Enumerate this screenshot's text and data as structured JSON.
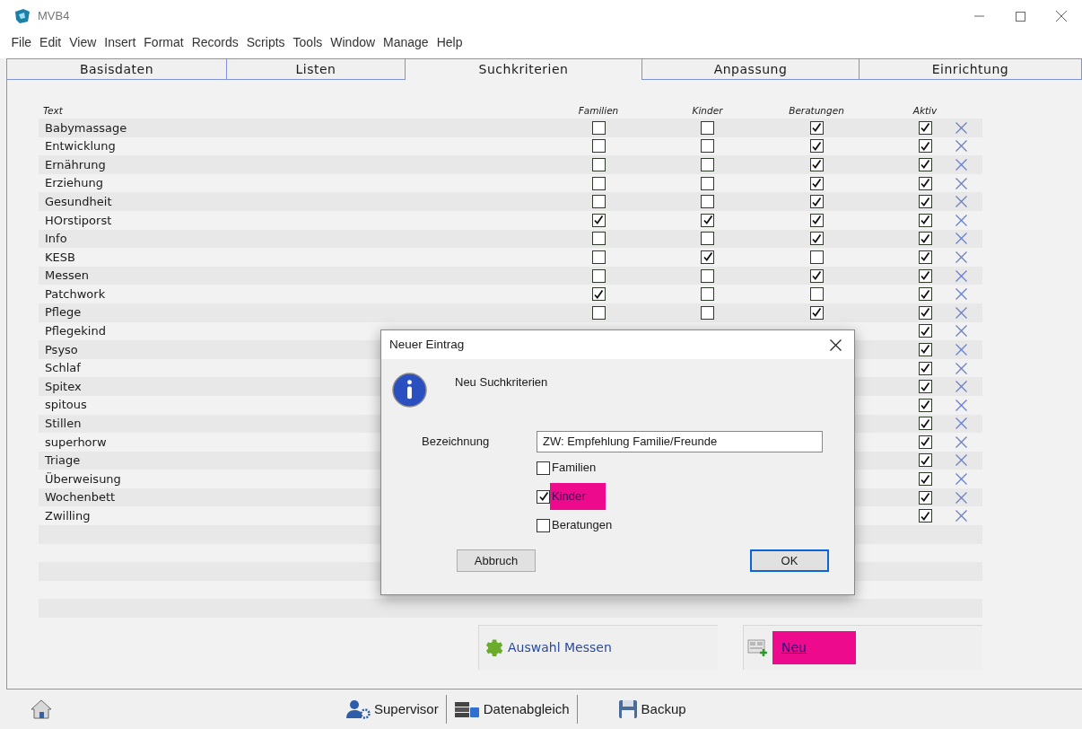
{
  "window": {
    "title": "MVB4"
  },
  "menu": [
    "File",
    "Edit",
    "View",
    "Insert",
    "Format",
    "Records",
    "Scripts",
    "Tools",
    "Window",
    "Manage",
    "Help"
  ],
  "tabs": [
    {
      "label": "Basisdaten",
      "selected": false
    },
    {
      "label": "Listen",
      "selected": false
    },
    {
      "label": "Suchkriterien",
      "selected": true
    },
    {
      "label": "Anpassung",
      "selected": false
    },
    {
      "label": "Einrichtung",
      "selected": false
    }
  ],
  "table": {
    "columns": [
      "Text",
      "Familien",
      "Kinder",
      "Beratungen",
      "Aktiv"
    ],
    "rows": [
      {
        "text": "Babymassage",
        "familien": false,
        "kinder": false,
        "beratungen": true,
        "aktiv": true
      },
      {
        "text": "Entwicklung",
        "familien": false,
        "kinder": false,
        "beratungen": true,
        "aktiv": true
      },
      {
        "text": "Ernährung",
        "familien": false,
        "kinder": false,
        "beratungen": true,
        "aktiv": true
      },
      {
        "text": "Erziehung",
        "familien": false,
        "kinder": false,
        "beratungen": true,
        "aktiv": true
      },
      {
        "text": "Gesundheit",
        "familien": false,
        "kinder": false,
        "beratungen": true,
        "aktiv": true
      },
      {
        "text": "HOrstiporst",
        "familien": true,
        "kinder": true,
        "beratungen": true,
        "aktiv": true
      },
      {
        "text": "Info",
        "familien": false,
        "kinder": false,
        "beratungen": true,
        "aktiv": true
      },
      {
        "text": "KESB",
        "familien": false,
        "kinder": true,
        "beratungen": false,
        "aktiv": true
      },
      {
        "text": "Messen",
        "familien": false,
        "kinder": false,
        "beratungen": true,
        "aktiv": true
      },
      {
        "text": "Patchwork",
        "familien": true,
        "kinder": false,
        "beratungen": false,
        "aktiv": true
      },
      {
        "text": "Pflege",
        "familien": false,
        "kinder": false,
        "beratungen": true,
        "aktiv": true
      },
      {
        "text": "Pflegekind",
        "aktiv": true
      },
      {
        "text": "Psyso",
        "aktiv": true
      },
      {
        "text": "Schlaf",
        "aktiv": true
      },
      {
        "text": "Spitex",
        "aktiv": true
      },
      {
        "text": "spitous",
        "aktiv": true
      },
      {
        "text": "Stillen",
        "aktiv": true
      },
      {
        "text": "superhorw",
        "aktiv": true
      },
      {
        "text": "Triage",
        "aktiv": true
      },
      {
        "text": "Überweisung",
        "aktiv": true
      },
      {
        "text": "Wochenbett",
        "aktiv": true
      },
      {
        "text": "Zwilling",
        "aktiv": true
      }
    ]
  },
  "actions": [
    {
      "label": "Auswahl Messen",
      "kind": "settings",
      "highlighted": false
    },
    {
      "label": "Neu",
      "kind": "new",
      "highlighted": true
    }
  ],
  "dialog": {
    "title": "Neuer Eintrag",
    "message": "Neu Suchkriterien",
    "field": {
      "label": "Bezeichnung",
      "value": "ZW: Empfehlung Familie/Freunde"
    },
    "options": [
      {
        "label": "Familien",
        "checked": false,
        "highlighted": false
      },
      {
        "label": "Kinder",
        "checked": true,
        "highlighted": true
      },
      {
        "label": "Beratungen",
        "checked": false,
        "highlighted": false
      }
    ],
    "buttons": [
      {
        "label": "Abbruch",
        "default": false
      },
      {
        "label": "OK",
        "default": true
      }
    ]
  },
  "footer": [
    {
      "label": "Supervisor",
      "kind": "supervisor"
    },
    {
      "label": "Datenabgleich",
      "kind": "sync"
    },
    {
      "label": "Backup",
      "kind": "backup"
    }
  ]
}
